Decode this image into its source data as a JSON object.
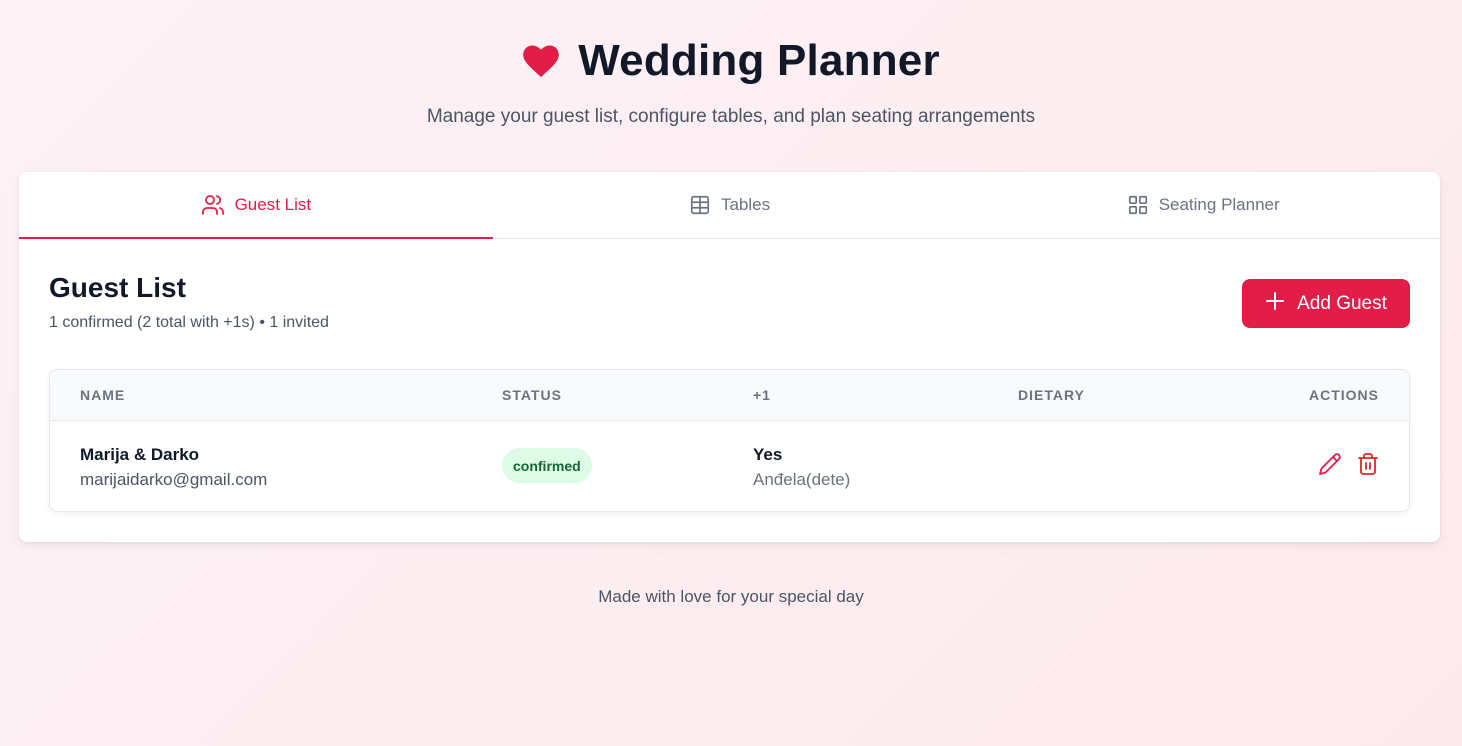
{
  "app": {
    "title": "Wedding Planner",
    "subtitle": "Manage your guest list, configure tables, and plan seating arrangements",
    "logo_icon": "heart-icon",
    "accent_color": "#e11d48"
  },
  "tabs": [
    {
      "label": "Guest List",
      "icon": "users-icon",
      "active": true
    },
    {
      "label": "Tables",
      "icon": "table-icon",
      "active": false
    },
    {
      "label": "Seating Planner",
      "icon": "grid-icon",
      "active": false
    }
  ],
  "guest_list": {
    "title": "Guest List",
    "summary": "1 confirmed (2 total with +1s) • 1 invited",
    "add_button_label": "Add Guest",
    "columns": [
      "NAME",
      "STATUS",
      "+1",
      "DIETARY",
      "ACTIONS"
    ],
    "rows": [
      {
        "name": "Marija & Darko",
        "email": "marijaidarko@gmail.com",
        "status": "confirmed",
        "plus_one": "Yes",
        "plus_one_name": "Anđela(dete)",
        "dietary": ""
      }
    ]
  },
  "footer": {
    "text": "Made with love for your special day"
  }
}
